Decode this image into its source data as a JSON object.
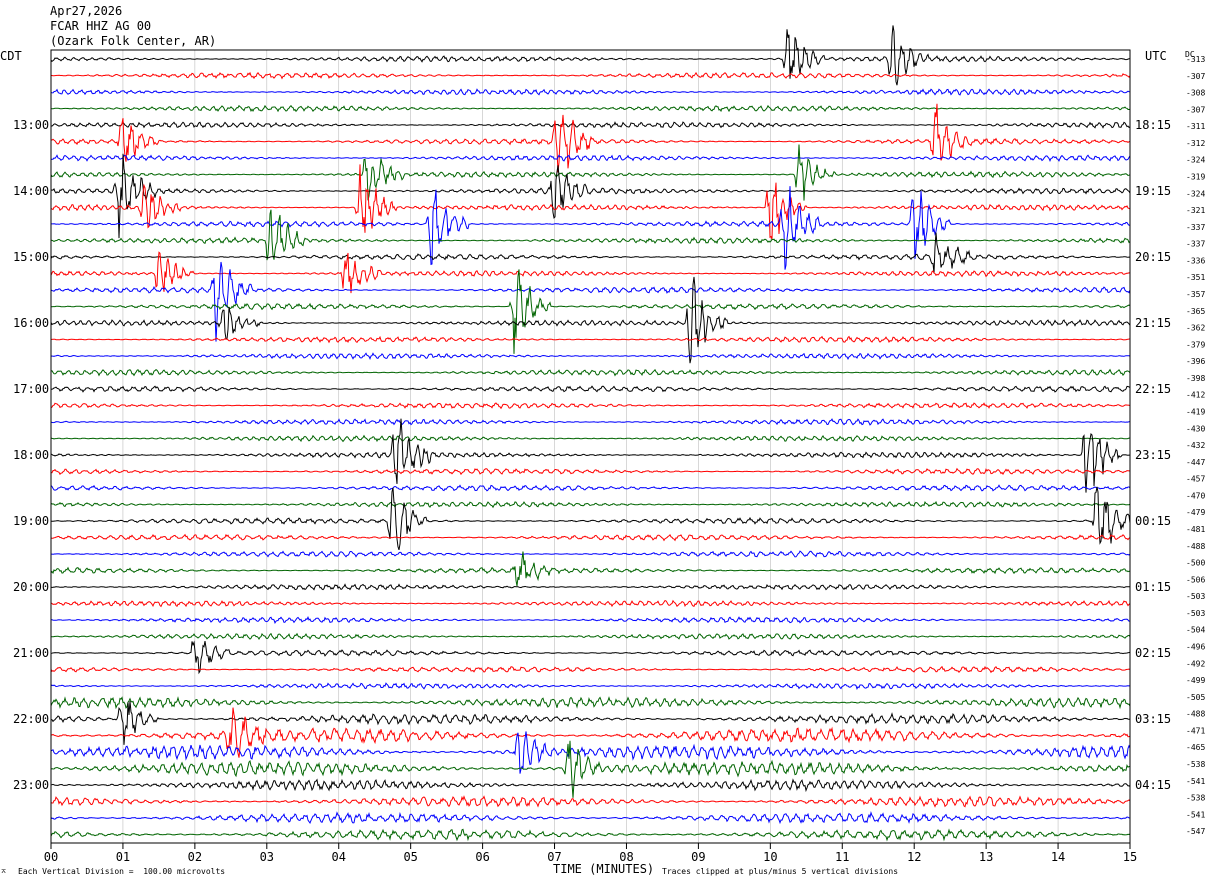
{
  "header": {
    "date": "Apr27,2026",
    "station": "FCAR HHZ AG 00",
    "location": "(Ozark Folk Center, AR)"
  },
  "axes": {
    "left_label": "CDT",
    "right_label": "UTC",
    "dc_label": "DC",
    "xlabel": "TIME (MINUTES)"
  },
  "footer": {
    "scale": "Each Vertical Division =  100.00 microvolts",
    "clip_note": "Traces clipped at plus/minus 5 vertical divisions"
  },
  "colors": {
    "trace_cycle": [
      "#000000",
      "#ff0000",
      "#0000ff",
      "#006400"
    ]
  },
  "chart_data": {
    "type": "helicorder",
    "trace_minutes": 15,
    "traces_count": 48,
    "x_ticks": [
      "00",
      "01",
      "02",
      "03",
      "04",
      "05",
      "06",
      "07",
      "08",
      "09",
      "10",
      "11",
      "12",
      "13",
      "14",
      "15"
    ],
    "left_time_labels": [
      "13:00",
      "14:00",
      "15:00",
      "16:00",
      "17:00",
      "18:00",
      "19:00",
      "20:00",
      "21:00",
      "22:00",
      "23:00"
    ],
    "right_time_labels": [
      "18:15",
      "19:15",
      "20:15",
      "21:15",
      "22:15",
      "23:15",
      "00:15",
      "01:15",
      "02:15",
      "03:15",
      "04:15"
    ],
    "label_trace_index_start": 4,
    "label_trace_step": 4,
    "dc_offsets": [
      -313,
      -307,
      -308,
      -307,
      -311,
      -312,
      -324,
      -319,
      -324,
      -321,
      -337,
      -337,
      -336,
      -351,
      -357,
      -365,
      -362,
      -379,
      -396,
      -398,
      -412,
      -419,
      -430,
      -432,
      -447,
      -457,
      -470,
      -479,
      -481,
      -488,
      -500,
      -506,
      -503,
      -503,
      -504,
      -496,
      -492,
      -499,
      -505,
      -488,
      -471,
      -465,
      -538,
      -541,
      -538,
      -541,
      -547
    ],
    "events": [
      {
        "trace": 0,
        "minute": 10.25,
        "amp": 1.2
      },
      {
        "trace": 0,
        "minute": 11.7,
        "amp": 1.1
      },
      {
        "trace": 5,
        "minute": 1.0,
        "amp": 1.0
      },
      {
        "trace": 5,
        "minute": 7.05,
        "amp": 1.6
      },
      {
        "trace": 5,
        "minute": 12.3,
        "amp": 1.4
      },
      {
        "trace": 7,
        "minute": 4.4,
        "amp": 1.3
      },
      {
        "trace": 7,
        "minute": 10.4,
        "amp": 1.2
      },
      {
        "trace": 8,
        "minute": 0.95,
        "amp": 1.5
      },
      {
        "trace": 8,
        "minute": 7.0,
        "amp": 1.0
      },
      {
        "trace": 9,
        "minute": 1.3,
        "amp": 0.9
      },
      {
        "trace": 9,
        "minute": 4.3,
        "amp": 1.6
      },
      {
        "trace": 9,
        "minute": 10.0,
        "amp": 1.4
      },
      {
        "trace": 10,
        "minute": 5.3,
        "amp": 1.6
      },
      {
        "trace": 10,
        "minute": 10.2,
        "amp": 1.5
      },
      {
        "trace": 10,
        "minute": 12.0,
        "amp": 1.6
      },
      {
        "trace": 11,
        "minute": 3.05,
        "amp": 1.5
      },
      {
        "trace": 12,
        "minute": 12.3,
        "amp": 1.0
      },
      {
        "trace": 13,
        "minute": 1.5,
        "amp": 1.0
      },
      {
        "trace": 13,
        "minute": 4.1,
        "amp": 1.0
      },
      {
        "trace": 14,
        "minute": 2.3,
        "amp": 1.6
      },
      {
        "trace": 15,
        "minute": 6.45,
        "amp": 1.7
      },
      {
        "trace": 16,
        "minute": 8.9,
        "amp": 1.6
      },
      {
        "trace": 16,
        "minute": 2.4,
        "amp": 0.8
      },
      {
        "trace": 24,
        "minute": 4.8,
        "amp": 1.6
      },
      {
        "trace": 24,
        "minute": 14.4,
        "amp": 1.8
      },
      {
        "trace": 28,
        "minute": 4.75,
        "amp": 1.6
      },
      {
        "trace": 28,
        "minute": 14.55,
        "amp": 1.6
      },
      {
        "trace": 31,
        "minute": 6.5,
        "amp": 0.7
      },
      {
        "trace": 36,
        "minute": 2.0,
        "amp": 0.8
      },
      {
        "trace": 40,
        "minute": 1.0,
        "amp": 0.9
      },
      {
        "trace": 41,
        "minute": 2.5,
        "amp": 1.0
      },
      {
        "trace": 42,
        "minute": 6.5,
        "amp": 1.0
      },
      {
        "trace": 43,
        "minute": 7.2,
        "amp": 1.1
      }
    ]
  }
}
